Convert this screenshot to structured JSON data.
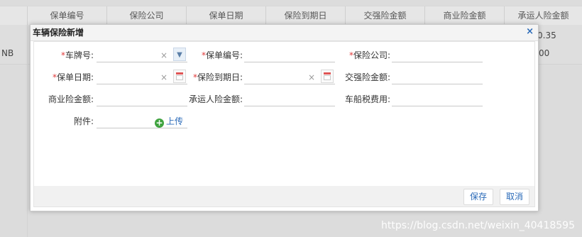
{
  "grid": {
    "columns": [
      "保单编号",
      "保险公司",
      "保单日期",
      "保险到期日",
      "交强险金额",
      "商业险金额",
      "承运人险金额"
    ],
    "rows": [
      {
        "left": "",
        "right": "0.35"
      },
      {
        "left": "NB",
        "right": "00"
      }
    ]
  },
  "dialog": {
    "title": "车辆保险新增",
    "close": "×",
    "fields": {
      "plate": {
        "label": "车牌号:",
        "required": "*",
        "value": ""
      },
      "policy_no": {
        "label": "保单编号:",
        "required": "*",
        "value": ""
      },
      "company": {
        "label": "保险公司:",
        "required": "*",
        "value": ""
      },
      "policy_date": {
        "label": "保单日期:",
        "required": "*",
        "value": ""
      },
      "expire_date": {
        "label": "保险到期日:",
        "required": "*",
        "value": ""
      },
      "compulsory": {
        "label": "交强险金额:",
        "value": ""
      },
      "commercial": {
        "label": "商业险金额:",
        "value": ""
      },
      "carrier": {
        "label": "承运人险金额:",
        "value": ""
      },
      "vessel_tax": {
        "label": "车船税费用:",
        "value": ""
      },
      "attachment": {
        "label": "附件:",
        "upload": "上传"
      }
    },
    "buttons": {
      "save": "保存",
      "cancel": "取消"
    }
  },
  "watermark": "https://blog.csdn.net/weixin_40418595",
  "icons": {
    "clear": "×",
    "dropdown": "chevron-down-icon",
    "calendar": "calendar-icon",
    "upload": "plus-circle-icon"
  },
  "colors": {
    "accent": "#2a6ab8",
    "required": "#e03b3b",
    "upload_icon": "#3fa33f"
  }
}
